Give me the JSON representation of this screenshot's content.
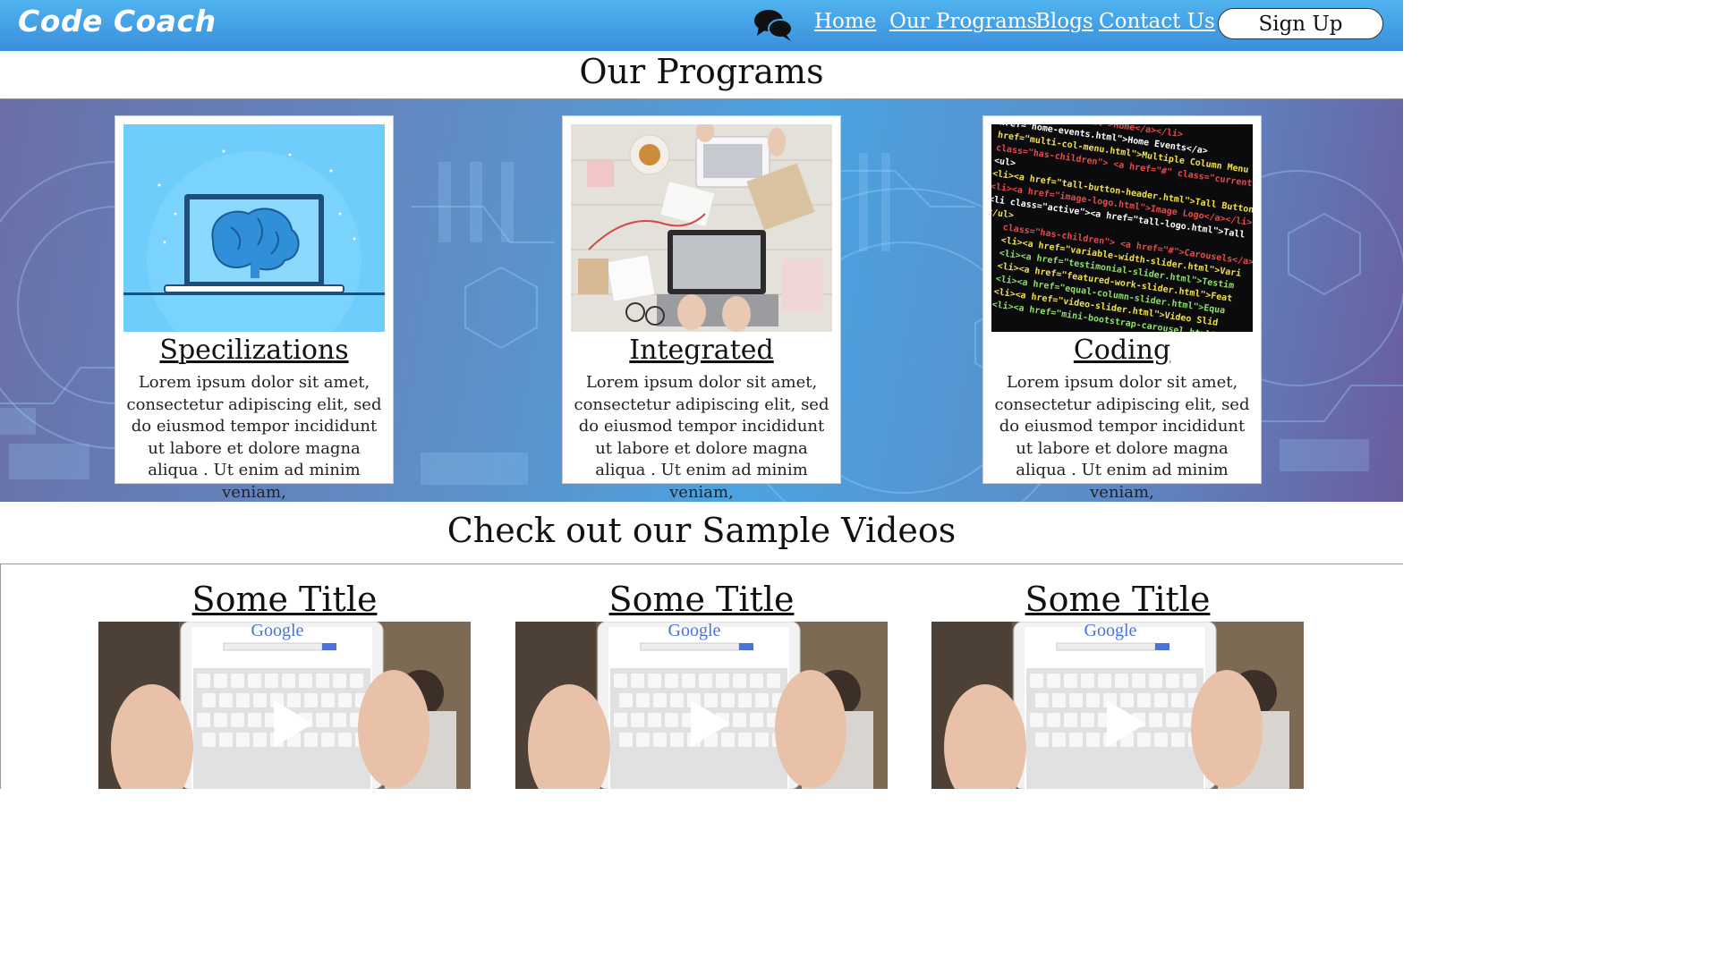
{
  "header": {
    "logo": "Code Coach",
    "nav": [
      "Home",
      "Our Programs",
      "Blogs",
      "Contact Us"
    ],
    "signup": "Sign Up"
  },
  "programs": {
    "title": "Our Programs",
    "cards": [
      {
        "title": "Specilizations",
        "text": "Lorem ipsum dolor sit amet, consectetur adipiscing elit, sed do eiusmod tempor incididunt ut labore et dolore magna aliqua . Ut enim ad minim veniam,"
      },
      {
        "title": "Integrated",
        "text": "Lorem ipsum dolor sit amet, consectetur adipiscing elit, sed do eiusmod tempor incididunt ut labore et dolore magna aliqua . Ut enim ad minim veniam,"
      },
      {
        "title": "Coding ",
        "text": "Lorem ipsum dolor sit amet, consectetur adipiscing elit, sed do eiusmod tempor incididunt ut labore et dolore magna aliqua . Ut enim ad minim veniam,"
      }
    ]
  },
  "videos": {
    "title": "Check out our Sample Videos",
    "items": [
      {
        "title": "Some Title "
      },
      {
        "title": "Some Title "
      },
      {
        "title": "Some Title "
      }
    ],
    "thumb_brand": "Google"
  },
  "colors": {
    "header_top": "#4fb3ee",
    "header_bottom": "#3a8fdc",
    "band_left": "#6b6fa8",
    "band_mid": "#4aa3e0",
    "brain_bg": "#6ecdfb",
    "brain": "#2f8fd8"
  },
  "code_lines": [
    "<a href=\"index.html\">Home</a></li>",
    "href=\"home-events.html\">Home Events</a>",
    "href=\"multi-col-menu.html\">Multiple Column Menu",
    "class=\"has-children\"> <a href=\"#\" class=\"current\">Head",
    "<ul>",
    "<li><a href=\"tall-button-header.html\">Tall Button",
    "<li><a href=\"image-logo.html\">Image Logo</a></li>",
    "<li class=\"active\"><a href=\"tall-logo.html\">Tall",
    "</ul>",
    "class=\"has-children\"> <a href=\"#\">Carousels</a>",
    "<li><a href=\"variable-width-slider.html\">Vari",
    "<li><a href=\"testimonial-slider.html\">Testim",
    "<li><a href=\"featured-work-slider.html\">Feat",
    "<li><a href=\"equal-column-slider.html\">Equa",
    "<li><a href=\"video-slider.html\">Video Slid",
    "<li><a href=\"mini-bootstrap-carousel.html\""
  ]
}
